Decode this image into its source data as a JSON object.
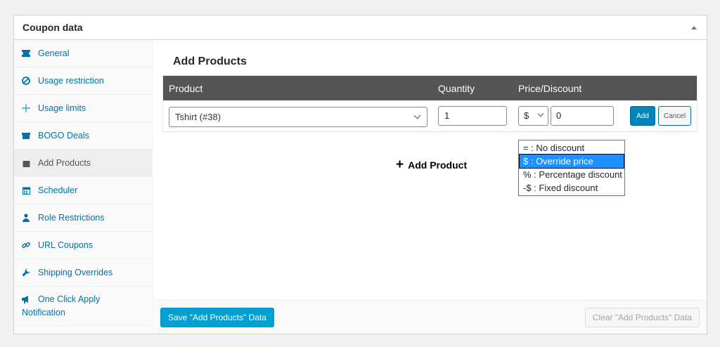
{
  "panel": {
    "title": "Coupon data"
  },
  "sidebar": {
    "items": [
      {
        "label": "General",
        "icon": "ticket-icon"
      },
      {
        "label": "Usage restriction",
        "icon": "no-entry-icon"
      },
      {
        "label": "Usage limits",
        "icon": "plus-icon"
      },
      {
        "label": "BOGO Deals",
        "icon": "gift-icon"
      },
      {
        "label": "Add Products",
        "icon": "bag-icon",
        "active": true
      },
      {
        "label": "Scheduler",
        "icon": "calendar-icon"
      },
      {
        "label": "Role Restrictions",
        "icon": "user-icon"
      },
      {
        "label": "URL Coupons",
        "icon": "link-icon"
      },
      {
        "label": "Shipping Overrides",
        "icon": "wrench-icon"
      },
      {
        "label_line1": "One Click Apply",
        "label_line2": "Notification",
        "icon": "megaphone-icon"
      }
    ]
  },
  "main": {
    "title": "Add Products",
    "table": {
      "headers": {
        "product": "Product",
        "quantity": "Quantity",
        "price": "Price/Discount"
      },
      "row": {
        "product": "Tshirt (#38)",
        "quantity": "1",
        "type": "$",
        "price": "0",
        "add_label": "Add",
        "cancel_label": "Cancel"
      }
    },
    "dropdown_options": [
      {
        "label": "= : No discount"
      },
      {
        "label": "$ : Override price",
        "selected": true
      },
      {
        "label": "% : Percentage discount"
      },
      {
        "label": "-$ : Fixed discount"
      }
    ],
    "add_product_label": "Add Product"
  },
  "footer": {
    "save_label": "Save \"Add Products\" Data",
    "clear_label": "Clear \"Add Products\" Data"
  },
  "colors": {
    "accent": "#0073aa",
    "primary_button": "#00a0d2",
    "table_header": "#545454"
  }
}
